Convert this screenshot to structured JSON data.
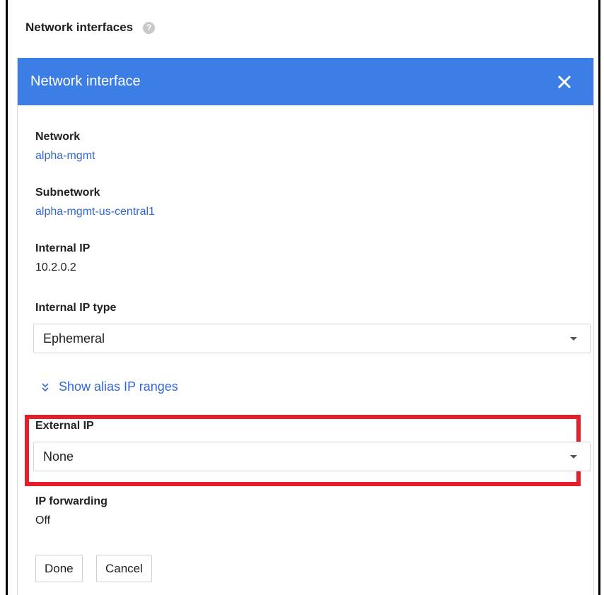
{
  "section": {
    "title": "Network interfaces",
    "help_icon": "?"
  },
  "panel": {
    "title": "Network interface"
  },
  "fields": {
    "network": {
      "label": "Network",
      "value": "alpha-mgmt"
    },
    "subnetwork": {
      "label": "Subnetwork",
      "value": "alpha-mgmt-us-central1"
    },
    "internal_ip": {
      "label": "Internal IP",
      "value": "10.2.0.2"
    },
    "internal_ip_type": {
      "label": "Internal IP type",
      "value": "Ephemeral"
    },
    "alias": {
      "label": "Show alias IP ranges"
    },
    "external_ip": {
      "label": "External IP",
      "value": "None"
    },
    "ip_forwarding": {
      "label": "IP forwarding",
      "value": "Off"
    }
  },
  "buttons": {
    "done": "Done",
    "cancel": "Cancel"
  },
  "colors": {
    "header": "#3c7de6",
    "link": "#3367d6",
    "highlight": "#e3202a"
  },
  "icons": {
    "help": "help-icon",
    "close": "close-icon",
    "alias": "chevrons-down-icon",
    "dropdown": "caret-down-icon"
  }
}
